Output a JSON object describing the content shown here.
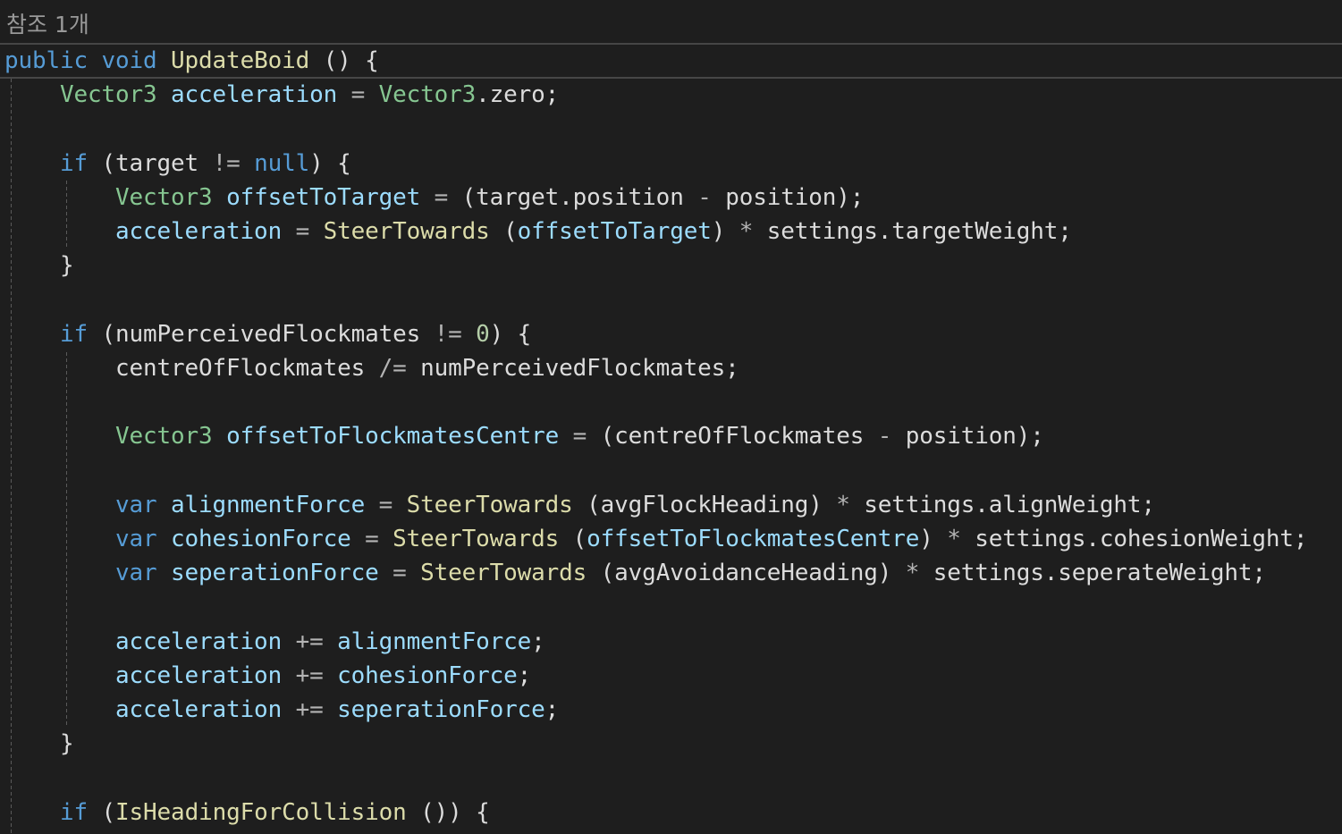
{
  "editor": {
    "theme": {
      "background": "#1e1e1e",
      "current_line_border": "#464646",
      "codelens_text": "#999999",
      "indent_guide": "#5a5a5a"
    },
    "codelens": {
      "references_label": "참조 1개"
    },
    "lines": [
      {
        "tokens": [
          {
            "text": "public void ",
            "color": "#569cd6"
          },
          {
            "text": "UpdateBoid",
            "color": "#dcdcaa"
          },
          {
            "text": " () {",
            "color": "#dcdcdc"
          }
        ]
      },
      {
        "tokens": [
          {
            "text": "    Vector3 ",
            "color": "#86c691"
          },
          {
            "text": "acceleration ",
            "color": "#9cdcfe"
          },
          {
            "text": "= ",
            "color": "#b4b4b4"
          },
          {
            "text": "Vector3",
            "color": "#86c691"
          },
          {
            "text": ".zero;",
            "color": "#dcdcdc"
          }
        ]
      },
      {
        "tokens": []
      },
      {
        "tokens": [
          {
            "text": "    if ",
            "color": "#569cd6"
          },
          {
            "text": "(target ",
            "color": "#dcdcdc"
          },
          {
            "text": "!= ",
            "color": "#b4b4b4"
          },
          {
            "text": "null",
            "color": "#569cd6"
          },
          {
            "text": ") {",
            "color": "#dcdcdc"
          }
        ]
      },
      {
        "tokens": [
          {
            "text": "        Vector3 ",
            "color": "#86c691"
          },
          {
            "text": "offsetToTarget ",
            "color": "#9cdcfe"
          },
          {
            "text": "= ",
            "color": "#b4b4b4"
          },
          {
            "text": "(target.position ",
            "color": "#dcdcdc"
          },
          {
            "text": "- ",
            "color": "#b4b4b4"
          },
          {
            "text": "position);",
            "color": "#dcdcdc"
          }
        ]
      },
      {
        "tokens": [
          {
            "text": "        acceleration ",
            "color": "#9cdcfe"
          },
          {
            "text": "= ",
            "color": "#b4b4b4"
          },
          {
            "text": "SteerTowards",
            "color": "#dcdcaa"
          },
          {
            "text": " (",
            "color": "#dcdcdc"
          },
          {
            "text": "offsetToTarget",
            "color": "#9cdcfe"
          },
          {
            "text": ") ",
            "color": "#dcdcdc"
          },
          {
            "text": "* ",
            "color": "#b4b4b4"
          },
          {
            "text": "settings.targetWeight;",
            "color": "#dcdcdc"
          }
        ]
      },
      {
        "tokens": [
          {
            "text": "    }",
            "color": "#dcdcdc"
          }
        ]
      },
      {
        "tokens": []
      },
      {
        "tokens": [
          {
            "text": "    if ",
            "color": "#569cd6"
          },
          {
            "text": "(numPerceivedFlockmates ",
            "color": "#dcdcdc"
          },
          {
            "text": "!= ",
            "color": "#b4b4b4"
          },
          {
            "text": "0",
            "color": "#b5cea8"
          },
          {
            "text": ") {",
            "color": "#dcdcdc"
          }
        ]
      },
      {
        "tokens": [
          {
            "text": "        centreOfFlockmates ",
            "color": "#dcdcdc"
          },
          {
            "text": "/= ",
            "color": "#b4b4b4"
          },
          {
            "text": "numPerceivedFlockmates;",
            "color": "#dcdcdc"
          }
        ]
      },
      {
        "tokens": []
      },
      {
        "tokens": [
          {
            "text": "        Vector3 ",
            "color": "#86c691"
          },
          {
            "text": "offsetToFlockmatesCentre ",
            "color": "#9cdcfe"
          },
          {
            "text": "= ",
            "color": "#b4b4b4"
          },
          {
            "text": "(centreOfFlockmates ",
            "color": "#dcdcdc"
          },
          {
            "text": "- ",
            "color": "#b4b4b4"
          },
          {
            "text": "position);",
            "color": "#dcdcdc"
          }
        ]
      },
      {
        "tokens": []
      },
      {
        "tokens": [
          {
            "text": "        var ",
            "color": "#569cd6"
          },
          {
            "text": "alignmentForce ",
            "color": "#9cdcfe"
          },
          {
            "text": "= ",
            "color": "#b4b4b4"
          },
          {
            "text": "SteerTowards",
            "color": "#dcdcaa"
          },
          {
            "text": " (avgFlockHeading) ",
            "color": "#dcdcdc"
          },
          {
            "text": "* ",
            "color": "#b4b4b4"
          },
          {
            "text": "settings.alignWeight;",
            "color": "#dcdcdc"
          }
        ]
      },
      {
        "tokens": [
          {
            "text": "        var ",
            "color": "#569cd6"
          },
          {
            "text": "cohesionForce ",
            "color": "#9cdcfe"
          },
          {
            "text": "= ",
            "color": "#b4b4b4"
          },
          {
            "text": "SteerTowards",
            "color": "#dcdcaa"
          },
          {
            "text": " (",
            "color": "#dcdcdc"
          },
          {
            "text": "offsetToFlockmatesCentre",
            "color": "#9cdcfe"
          },
          {
            "text": ") ",
            "color": "#dcdcdc"
          },
          {
            "text": "* ",
            "color": "#b4b4b4"
          },
          {
            "text": "settings.cohesionWeight;",
            "color": "#dcdcdc"
          }
        ]
      },
      {
        "tokens": [
          {
            "text": "        var ",
            "color": "#569cd6"
          },
          {
            "text": "seperationForce ",
            "color": "#9cdcfe"
          },
          {
            "text": "= ",
            "color": "#b4b4b4"
          },
          {
            "text": "SteerTowards",
            "color": "#dcdcaa"
          },
          {
            "text": " (avgAvoidanceHeading) ",
            "color": "#dcdcdc"
          },
          {
            "text": "* ",
            "color": "#b4b4b4"
          },
          {
            "text": "settings.seperateWeight;",
            "color": "#dcdcdc"
          }
        ]
      },
      {
        "tokens": []
      },
      {
        "tokens": [
          {
            "text": "        acceleration ",
            "color": "#9cdcfe"
          },
          {
            "text": "+= ",
            "color": "#b4b4b4"
          },
          {
            "text": "alignmentForce",
            "color": "#9cdcfe"
          },
          {
            "text": ";",
            "color": "#dcdcdc"
          }
        ]
      },
      {
        "tokens": [
          {
            "text": "        acceleration ",
            "color": "#9cdcfe"
          },
          {
            "text": "+= ",
            "color": "#b4b4b4"
          },
          {
            "text": "cohesionForce",
            "color": "#9cdcfe"
          },
          {
            "text": ";",
            "color": "#dcdcdc"
          }
        ]
      },
      {
        "tokens": [
          {
            "text": "        acceleration ",
            "color": "#9cdcfe"
          },
          {
            "text": "+= ",
            "color": "#b4b4b4"
          },
          {
            "text": "seperationForce",
            "color": "#9cdcfe"
          },
          {
            "text": ";",
            "color": "#dcdcdc"
          }
        ]
      },
      {
        "tokens": [
          {
            "text": "    }",
            "color": "#dcdcdc"
          }
        ]
      },
      {
        "tokens": []
      },
      {
        "tokens": [
          {
            "text": "    if ",
            "color": "#569cd6"
          },
          {
            "text": "(",
            "color": "#dcdcdc"
          },
          {
            "text": "IsHeadingForCollision",
            "color": "#dcdcaa"
          },
          {
            "text": " ()) {",
            "color": "#dcdcdc"
          }
        ]
      }
    ]
  }
}
